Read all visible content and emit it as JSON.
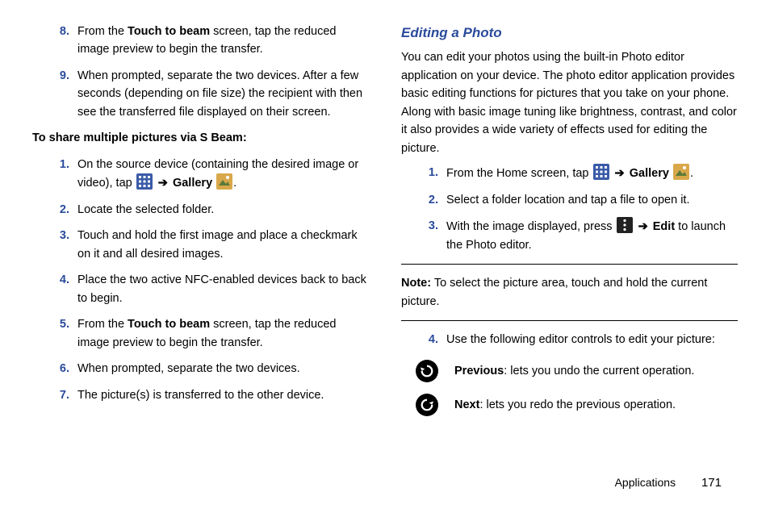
{
  "left": {
    "items_a": [
      {
        "n": "8.",
        "parts": [
          "From the ",
          {
            "b": "Touch to beam"
          },
          " screen, tap the reduced image preview to begin the transfer."
        ]
      },
      {
        "n": "9.",
        "parts": [
          "When prompted, separate the two devices. After a few seconds (depending on file size) the recipient with then see the transferred file displayed on their screen."
        ]
      }
    ],
    "subhead": "To share multiple pictures via S Beam:",
    "items_b": [
      {
        "n": "1.",
        "parts": [
          "On the source device (containing the desired image or video), tap ",
          {
            "icon": "apps"
          },
          " ",
          {
            "arrow": "➔"
          },
          " ",
          {
            "b": "Gallery"
          },
          " ",
          {
            "icon": "gallery"
          },
          "."
        ]
      },
      {
        "n": "2.",
        "parts": [
          "Locate the selected folder."
        ]
      },
      {
        "n": "3.",
        "parts": [
          "Touch and hold the first image and place a checkmark on it and all desired images."
        ]
      },
      {
        "n": "4.",
        "parts": [
          "Place the two active NFC-enabled devices back to back to begin."
        ]
      },
      {
        "n": "5.",
        "parts": [
          "From the ",
          {
            "b": "Touch to beam"
          },
          " screen, tap the reduced image preview to begin the transfer."
        ]
      },
      {
        "n": "6.",
        "parts": [
          "When prompted, separate the two devices."
        ]
      },
      {
        "n": "7.",
        "parts": [
          "The picture(s) is transferred to the other device."
        ]
      }
    ]
  },
  "right": {
    "title": "Editing a Photo",
    "intro": "You can edit your photos using the built-in Photo editor application on your device. The photo editor application provides basic editing functions for pictures that you take on your phone. Along with basic image tuning like brightness, contrast, and color it also provides a wide variety of effects used for editing the picture.",
    "items": [
      {
        "n": "1.",
        "parts": [
          "From the Home screen, tap ",
          {
            "icon": "apps"
          },
          " ",
          {
            "arrow": "➔"
          },
          " ",
          {
            "b": "Gallery"
          },
          " ",
          {
            "icon": "gallery"
          },
          "."
        ]
      },
      {
        "n": "2.",
        "parts": [
          "Select a folder location and tap a file to open it."
        ]
      },
      {
        "n": "3.",
        "parts": [
          "With the image displayed, press ",
          {
            "icon": "menu"
          },
          " ",
          {
            "arrow": "➔"
          },
          " ",
          {
            "b": "Edit"
          },
          " to launch the Photo editor."
        ]
      }
    ],
    "note_label": "Note:",
    "note_text": " To select the picture area, touch and hold the current picture.",
    "items2": [
      {
        "n": "4.",
        "parts": [
          "Use the following editor controls to edit your picture:"
        ]
      }
    ],
    "controls": [
      {
        "icon": "undo",
        "label": "Previous",
        "desc": ": lets you undo the current operation."
      },
      {
        "icon": "redo",
        "label": "Next",
        "desc": ": lets you redo the previous operation."
      }
    ]
  },
  "footer": {
    "section": "Applications",
    "page": "171"
  }
}
